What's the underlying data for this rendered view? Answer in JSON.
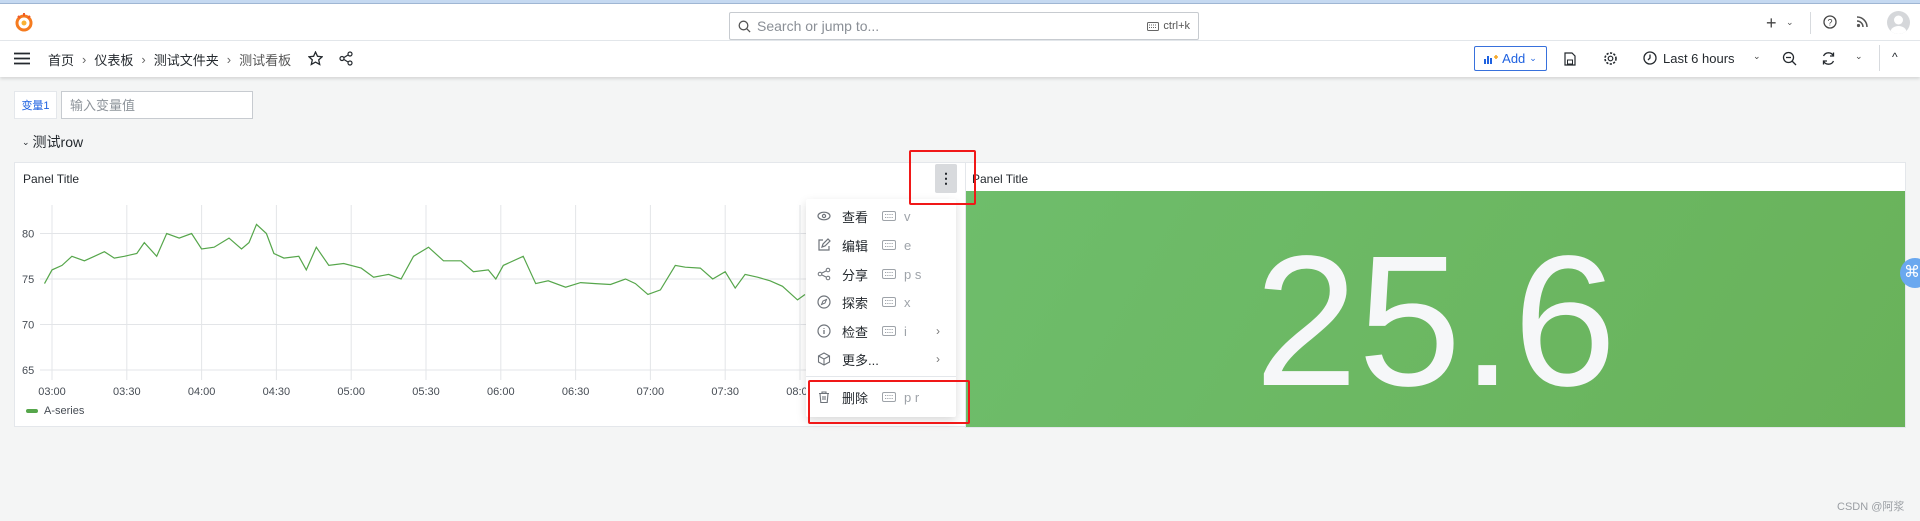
{
  "topbar": {
    "search_placeholder": "Search or jump to...",
    "search_shortcut": "ctrl+k",
    "icons": [
      "grafana-logo-icon",
      "search-icon",
      "keyboard-icon",
      "plus-icon",
      "chevron-down-icon",
      "help-icon",
      "rss-icon",
      "avatar"
    ]
  },
  "breadcrumb": [
    "首页",
    "仪表板",
    "测试文件夹",
    "测试看板"
  ],
  "toolbar": {
    "add_label": "Add",
    "time_range": "Last 6 hours",
    "accent": "#1f62e0"
  },
  "variable": {
    "label": "变量1",
    "placeholder": "输入变量值",
    "value": ""
  },
  "row": {
    "title": "测试row"
  },
  "panels": [
    {
      "title": "Panel Title",
      "legend": "A-series"
    },
    {
      "title": "Panel Title",
      "value": "25.6",
      "color": "#6bb765"
    }
  ],
  "context_menu": {
    "items": [
      {
        "label": "查看",
        "shortcut": "v",
        "icon": "eye-icon",
        "submenu": false
      },
      {
        "label": "编辑",
        "shortcut": "e",
        "icon": "edit-icon",
        "submenu": false
      },
      {
        "label": "分享",
        "shortcut": "p s",
        "icon": "share-icon",
        "submenu": false
      },
      {
        "label": "探索",
        "shortcut": "x",
        "icon": "compass-icon",
        "submenu": false
      },
      {
        "label": "检查",
        "shortcut": "i",
        "icon": "info-icon",
        "submenu": true
      },
      {
        "label": "更多...",
        "shortcut": "",
        "icon": "cube-icon",
        "submenu": true
      },
      {
        "label": "删除",
        "shortcut": "p r",
        "icon": "trash-icon",
        "submenu": false
      }
    ]
  },
  "watermark": "CSDN @阿浆",
  "chart_data": {
    "type": "line",
    "title": "Panel Title",
    "xlabel": "",
    "ylabel": "",
    "x_ticks": [
      "03:00",
      "03:30",
      "04:00",
      "04:30",
      "05:00",
      "05:30",
      "06:00",
      "06:30",
      "07:00",
      "07:30",
      "08:00"
    ],
    "y_ticks": [
      65,
      70,
      75,
      80
    ],
    "ylim": [
      64,
      82.5
    ],
    "grid": true,
    "legend": "bottom-left",
    "series": [
      {
        "name": "A-series",
        "color": "#56a64b",
        "x": [
          "02:57",
          "03:00",
          "03:04",
          "03:08",
          "03:13",
          "03:17",
          "03:21",
          "03:25",
          "03:29",
          "03:34",
          "03:37",
          "03:42",
          "03:46",
          "03:51",
          "03:56",
          "04:00",
          "04:05",
          "04:11",
          "04:16",
          "04:19",
          "04:22",
          "04:26",
          "04:29",
          "04:33",
          "04:39",
          "04:42",
          "04:46",
          "04:51",
          "04:57",
          "05:04",
          "05:09",
          "05:15",
          "05:20",
          "05:25",
          "05:31",
          "05:37",
          "05:44",
          "05:49",
          "05:55",
          "05:58",
          "06:01",
          "06:09",
          "06:14",
          "06:19",
          "06:26",
          "06:32",
          "06:38",
          "06:44",
          "06:50",
          "06:54",
          "06:59",
          "07:04",
          "07:10",
          "07:14",
          "07:20",
          "07:25",
          "07:30",
          "07:34",
          "07:38",
          "07:43",
          "07:48",
          "07:53",
          "07:59",
          "08:02"
        ],
        "y": [
          74.5,
          76,
          76.5,
          77.5,
          77,
          77.5,
          78,
          77.3,
          77.5,
          77.8,
          79,
          77.5,
          80,
          79.5,
          80,
          78.3,
          78.5,
          79.5,
          78.3,
          79,
          81,
          80,
          77.8,
          77.3,
          77.5,
          76,
          78.5,
          76.5,
          76.7,
          76.2,
          75.2,
          75.5,
          75,
          77.5,
          78.5,
          77,
          77,
          75.8,
          76,
          75,
          76.5,
          77.5,
          74.5,
          74.8,
          74.1,
          74.6,
          74.5,
          74.4,
          75,
          74.5,
          73.3,
          73.8,
          76.5,
          76.3,
          76.2,
          75,
          75.8,
          74,
          75.5,
          75.2,
          74.8,
          74.2,
          72.7,
          73.3
        ]
      }
    ]
  }
}
